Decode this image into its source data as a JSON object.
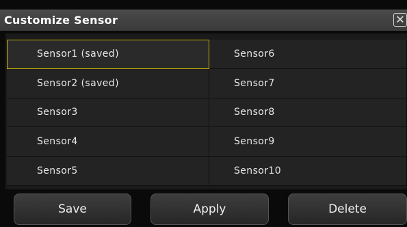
{
  "dialog": {
    "title": "Customize Sensor",
    "close_glyph": "✕",
    "close_icon": "close-icon"
  },
  "sensors": {
    "left": [
      "Sensor1 (saved)",
      "Sensor2 (saved)",
      "Sensor3",
      "Sensor4",
      "Sensor5"
    ],
    "right": [
      "Sensor6",
      "Sensor7",
      "Sensor8",
      "Sensor9",
      "Sensor10"
    ],
    "selected": "Sensor1 (saved)"
  },
  "buttons": {
    "save": "Save",
    "apply": "Apply",
    "delete": "Delete"
  },
  "colors": {
    "selection_outline": "#c8b400",
    "title_bar": "#444444",
    "cell_bg": "#232323"
  }
}
